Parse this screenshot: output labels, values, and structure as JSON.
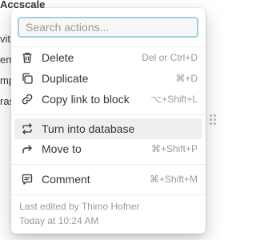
{
  "background": {
    "title_fragment": "Accscale",
    "line_fragments": [
      "vit",
      "em",
      "mp",
      "ras"
    ]
  },
  "menu": {
    "search": {
      "placeholder": "Search actions...",
      "value": ""
    },
    "items": [
      {
        "label": "Delete",
        "shortcut": "Del or Ctrl+D",
        "icon": "trash-icon"
      },
      {
        "label": "Duplicate",
        "shortcut": "⌘+D",
        "icon": "duplicate-icon"
      },
      {
        "label": "Copy link to block",
        "shortcut": "⌥+Shift+L",
        "icon": "link-icon"
      },
      {
        "label": "Turn into database",
        "shortcut": "",
        "icon": "turn-into-icon"
      },
      {
        "label": "Move to",
        "shortcut": "⌘+Shift+P",
        "icon": "move-arrow-icon"
      },
      {
        "label": "Comment",
        "shortcut": "⌘+Shift+M",
        "icon": "comment-icon"
      }
    ],
    "footer": {
      "edited_by": "Last edited by Thimo Hofner",
      "edited_time": "Today at 10:24 AM"
    }
  }
}
